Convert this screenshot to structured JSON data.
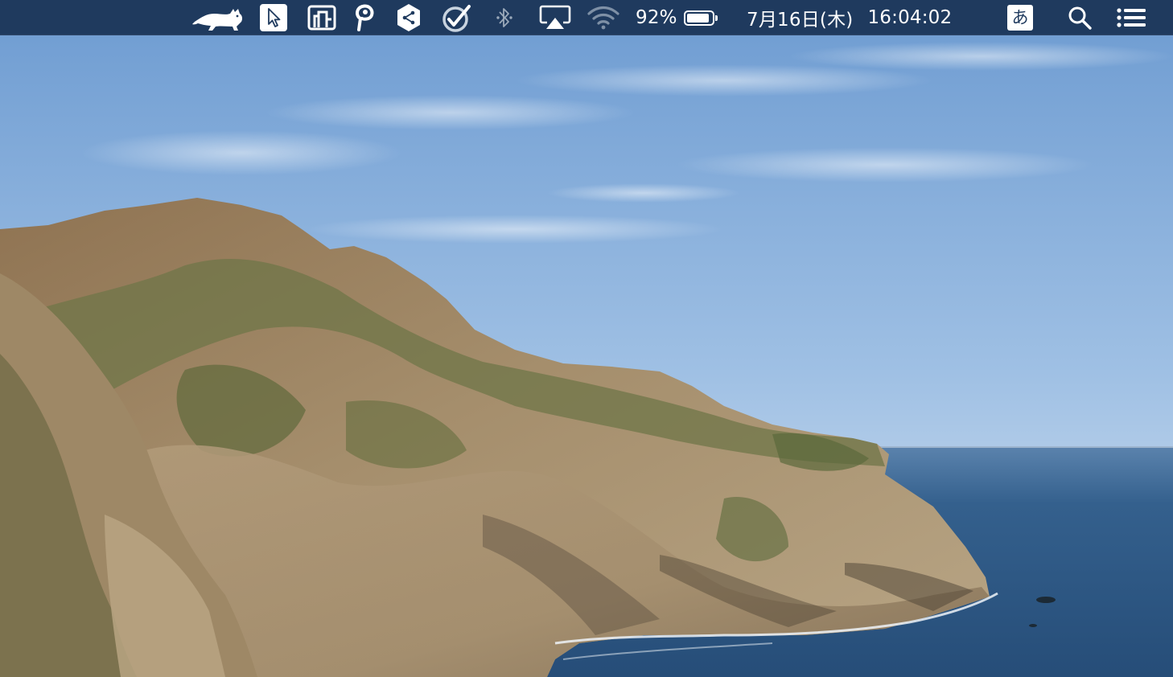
{
  "menubar": {
    "background": "#1f3a5e",
    "status_icons": [
      {
        "icon": "cat-icon"
      },
      {
        "icon": "cursor-pro-icon"
      },
      {
        "icon": "magnet-icon"
      },
      {
        "icon": "parking-icon"
      },
      {
        "icon": "cube-share-icon"
      },
      {
        "icon": "omnifocus-check-icon"
      },
      {
        "icon": "bluetooth-icon",
        "dimmed": true
      },
      {
        "icon": "airplay-icon"
      },
      {
        "icon": "wifi-icon",
        "dimmed": true
      }
    ],
    "battery": {
      "percent_label": "92%",
      "level": 0.92
    },
    "clock": {
      "date": "7月16日(木)",
      "time": "16:04:02"
    },
    "input_method": {
      "label": "あ"
    },
    "spotlight": {
      "icon": "search-icon"
    },
    "notification_center": {
      "icon": "list-icon"
    }
  },
  "desktop": {
    "wallpaper": "catalina-coastline",
    "sky_top": "#6e9dd2",
    "sky_bottom": "#d6e4f2",
    "ocean": "#2f5a86",
    "cliff": "#a89170",
    "vegetation": "#6f7548"
  }
}
